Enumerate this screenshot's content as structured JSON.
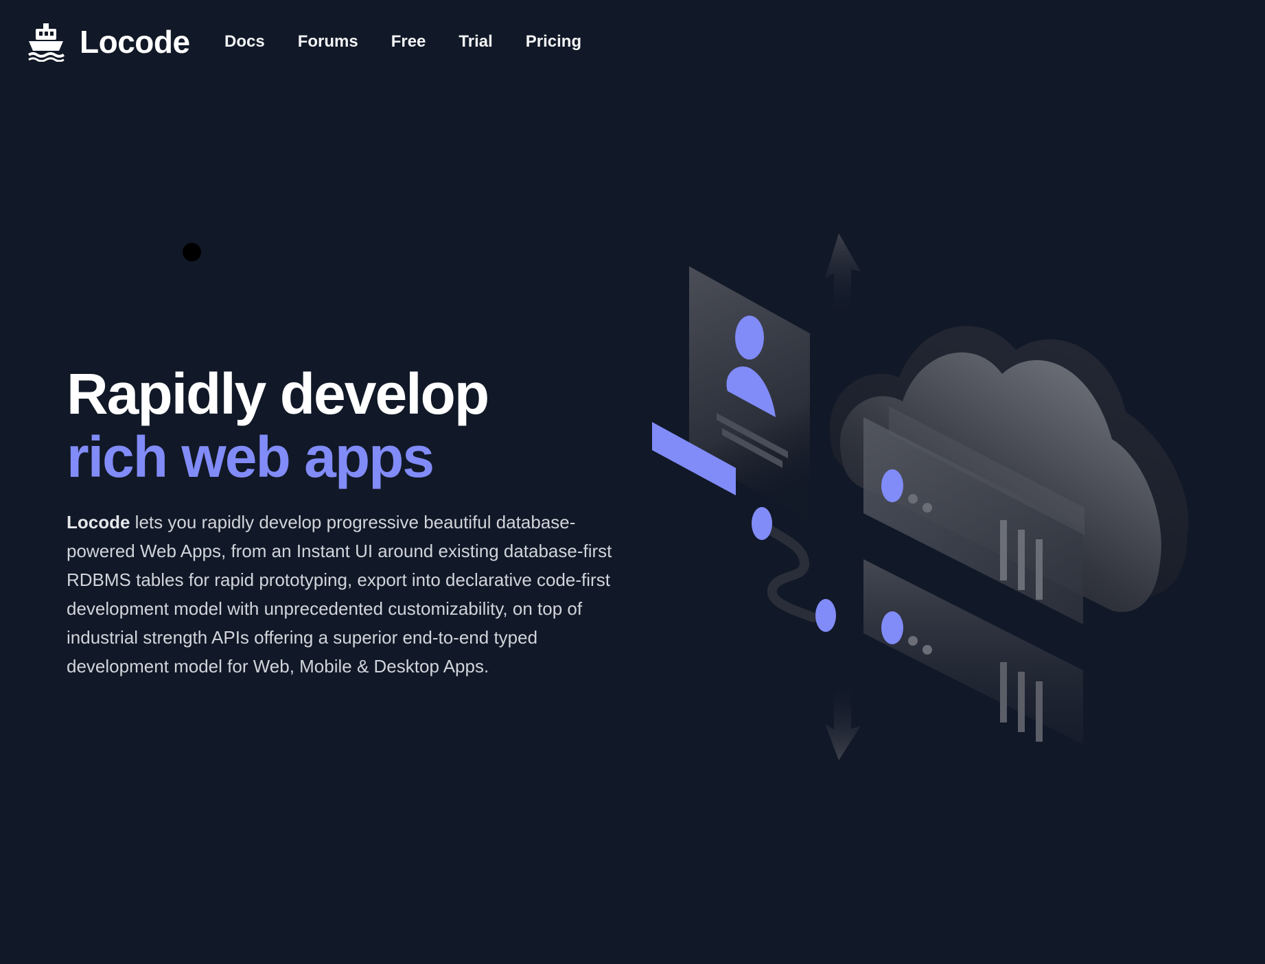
{
  "brand": {
    "name": "Locode",
    "logo_icon": "ship-icon"
  },
  "nav": {
    "items": [
      {
        "label": "Docs"
      },
      {
        "label": "Forums"
      },
      {
        "label": "Free"
      },
      {
        "label": "Trial"
      },
      {
        "label": "Pricing"
      }
    ]
  },
  "hero": {
    "title_line1": "Rapidly develop",
    "title_line2": "rich web apps",
    "description_strong": "Locode",
    "description_rest": " lets you rapidly develop progressive beautiful database-powered Web Apps, from an Instant UI around existing database-first RDBMS tables for rapid prototyping, export into declarative code-first development model with unprecedented customizability, on top of industrial strength APIs offering a superior end-to-end typed development model for Web, Mobile & Desktop Apps."
  },
  "illustration": {
    "icon": "cloud-servers-illustration"
  },
  "colors": {
    "background": "#111827",
    "accent": "#818cf8",
    "heading": "#ffffff",
    "body_text": "#d1d5db"
  }
}
